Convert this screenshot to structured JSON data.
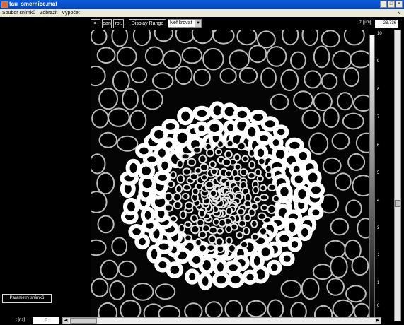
{
  "window": {
    "title": "tau_smernice.mat",
    "buttons": [
      "_",
      "□",
      "×"
    ]
  },
  "menu": {
    "items": [
      "Soubor snímků",
      "Zobrazit",
      "Výpočet"
    ]
  },
  "toolbar": {
    "back_label": "<-",
    "pan_label": "pan",
    "rot_label": "rot.",
    "display_range_label": "Display Range",
    "filter_value": "Nefiltrovat"
  },
  "z": {
    "label": "z [µm]",
    "value": "23.736"
  },
  "colorbar": {
    "ticks": [
      "10",
      "9",
      "8",
      "7",
      "6",
      "5",
      "4",
      "3",
      "2",
      "1",
      "0"
    ]
  },
  "bottom": {
    "params_button": "Parametry snímků",
    "t_label": "t [ns]",
    "t_value": "0"
  },
  "colors": {
    "accent_title": "#0a5cdc",
    "background": "#000000",
    "image_highlight": "#ffffff"
  }
}
